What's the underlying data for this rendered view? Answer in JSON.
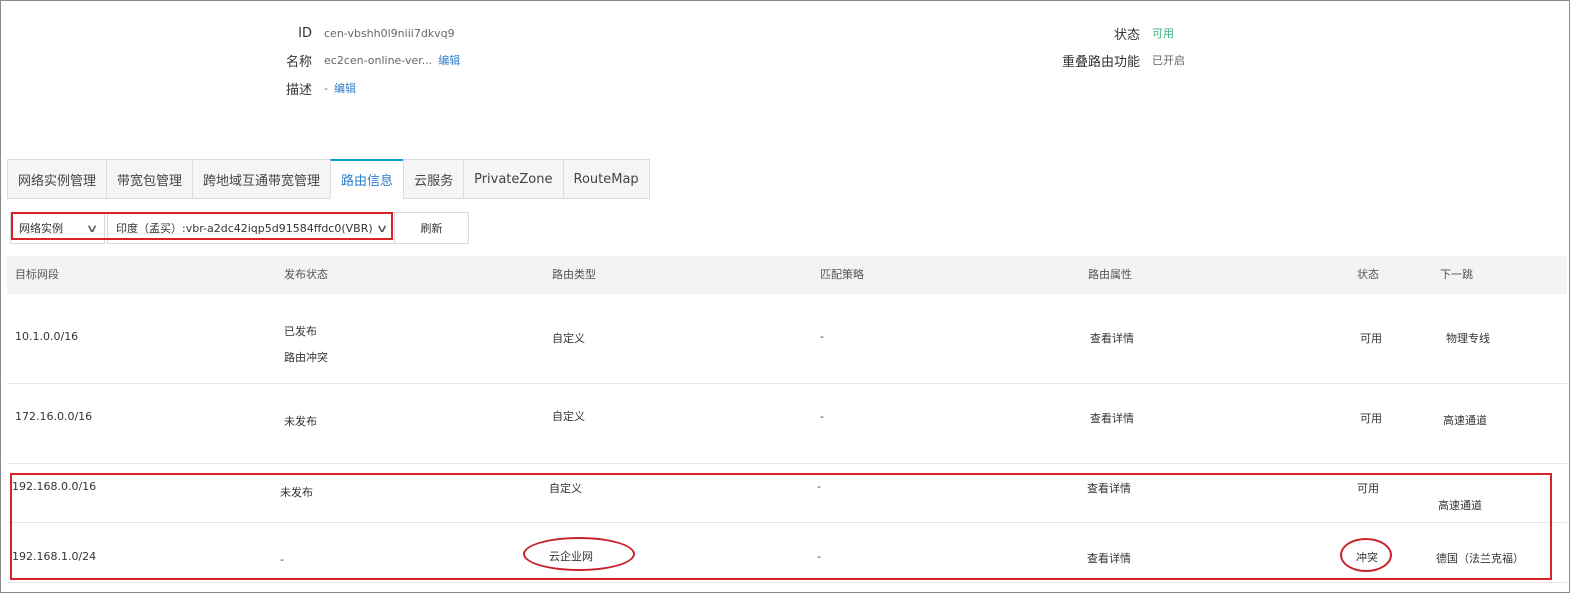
{
  "info": {
    "id_label": "ID",
    "id_value": "cen-vbshh0l9niii7dkvq9",
    "name_label": "名称",
    "name_value": "ec2cen-online-ver...",
    "name_edit": "编辑",
    "desc_label": "描述",
    "desc_value": "-",
    "desc_edit": "编辑",
    "status_label": "状态",
    "status_value": "可用",
    "overlap_label": "重叠路由功能",
    "overlap_value": "已开启"
  },
  "tabs": [
    {
      "label": "网络实例管理"
    },
    {
      "label": "带宽包管理"
    },
    {
      "label": "跨地域互通带宽管理"
    },
    {
      "label": "路由信息",
      "active": true
    },
    {
      "label": "云服务"
    },
    {
      "label": "PrivateZone"
    },
    {
      "label": "RouteMap"
    }
  ],
  "filter": {
    "type_select": "网络实例",
    "instance_select": "印度（孟买）:vbr-a2dc42iqp5d91584ffdc0(VBR)",
    "refresh": "刷新"
  },
  "table": {
    "columns": [
      "目标网段",
      "发布状态",
      "路由类型",
      "匹配策略",
      "路由属性",
      "状态",
      "下一跳"
    ],
    "rows": [
      {
        "cidr": "10.1.0.0/16",
        "publish": "已发布",
        "publish_link": "路由冲突",
        "type": "自定义",
        "policy": "-",
        "attr": "查看详情",
        "status": "可用",
        "next_hop": "物理专线"
      },
      {
        "cidr": "172.16.0.0/16",
        "publish": "未发布",
        "type": "自定义",
        "policy": "-",
        "attr": "查看详情",
        "status": "可用",
        "next_hop": "高速通道"
      },
      {
        "cidr": "192.168.0.0/16",
        "publish": "未发布",
        "type": "自定义",
        "policy": "-",
        "attr": "查看详情",
        "status": "可用",
        "next_hop": "高速通道"
      },
      {
        "cidr": "192.168.1.0/24",
        "publish": "-",
        "type": "云企业网",
        "policy": "-",
        "attr": "查看详情",
        "status": "冲突",
        "next_hop": "德国（法兰克福）"
      }
    ]
  },
  "colors": {
    "link": "#2f7fc9",
    "status_ok": "#3fb27f",
    "highlight_red": "#d8232a",
    "tab_active_border": "#00a2ca"
  }
}
